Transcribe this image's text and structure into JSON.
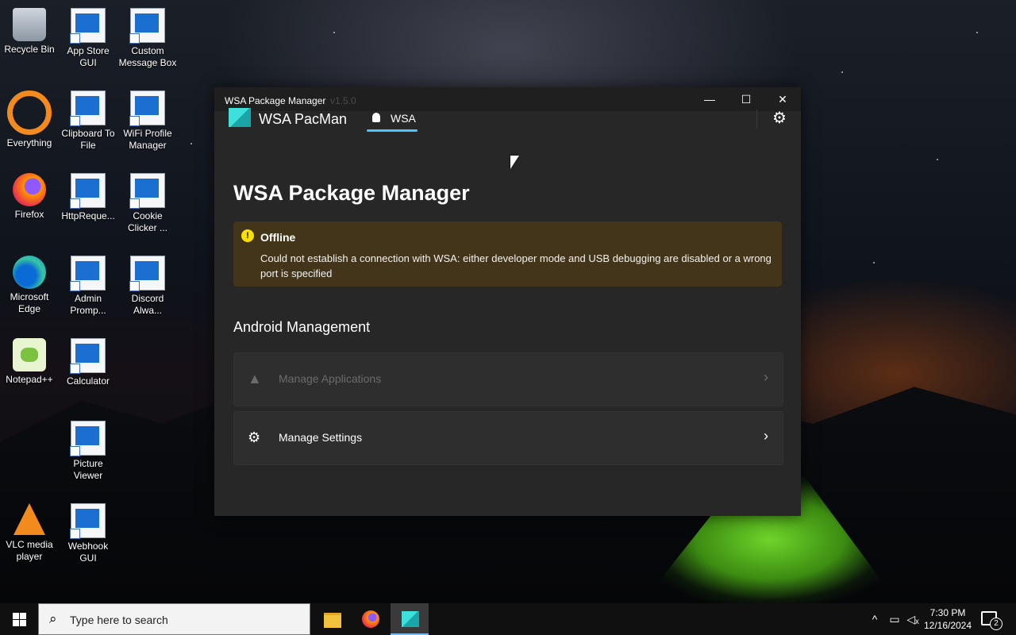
{
  "desktop": {
    "icons": [
      {
        "label": "Recycle Bin",
        "icon": "recycle-bin-icon"
      },
      {
        "label": "App Store GUI",
        "icon": "shortcut-icon"
      },
      {
        "label": "Custom Message Box",
        "icon": "shortcut-icon"
      },
      {
        "label": "Everything",
        "icon": "everything-search-icon"
      },
      {
        "label": "Clipboard To File",
        "icon": "shortcut-icon"
      },
      {
        "label": "WiFi Profile Manager",
        "icon": "shortcut-icon"
      },
      {
        "label": "Firefox",
        "icon": "firefox-icon"
      },
      {
        "label": "HttpReque...",
        "icon": "shortcut-icon"
      },
      {
        "label": "Cookie Clicker ...",
        "icon": "shortcut-icon"
      },
      {
        "label": "Microsoft Edge",
        "icon": "edge-icon"
      },
      {
        "label": "Admin Promp...",
        "icon": "shortcut-icon"
      },
      {
        "label": "Discord Alwa...",
        "icon": "shortcut-icon"
      },
      {
        "label": "Notepad++",
        "icon": "notepad-plus-plus-icon"
      },
      {
        "label": "Calculator",
        "icon": "shortcut-icon"
      },
      {
        "label": "Picture Viewer",
        "icon": "shortcut-icon"
      },
      {
        "label": "VLC media player",
        "icon": "vlc-cone-icon"
      },
      {
        "label": "Webhook GUI",
        "icon": "shortcut-icon"
      }
    ]
  },
  "window": {
    "title": "WSA Package Manager",
    "version": "v1.5.0",
    "controls": {
      "minimize": "—",
      "maximize": "☐",
      "close": "✕"
    },
    "nav": {
      "app_name": "WSA PacMan",
      "tab_label": "WSA",
      "settings_icon": "gear-icon"
    },
    "page_title": "WSA Package Manager",
    "infobar": {
      "severity": "warning",
      "title": "Offline",
      "message": "Could not establish a connection with WSA: either developer mode and USB debugging are disabled or a wrong port is specified"
    },
    "section_title": "Android Management",
    "cards": [
      {
        "label": "Manage Applications",
        "icon": "android-icon",
        "enabled": false
      },
      {
        "label": "Manage Settings",
        "icon": "gears-icon",
        "enabled": true
      }
    ]
  },
  "taskbar": {
    "search_placeholder": "Type here to search",
    "apps": [
      "file-explorer-icon",
      "firefox-icon",
      "wsa-pacman-icon"
    ],
    "active_app": "wsa-pacman-icon",
    "tray_icons": [
      "chevron-up-icon",
      "network-icon",
      "volume-muted-icon"
    ],
    "time": "7:30 PM",
    "date": "12/16/2024",
    "notification_count": "2"
  },
  "colors": {
    "accent": "#4cc2ff",
    "infobar_bg": "#433519",
    "warning_icon": "#fce100",
    "window_bg": "#272727"
  }
}
